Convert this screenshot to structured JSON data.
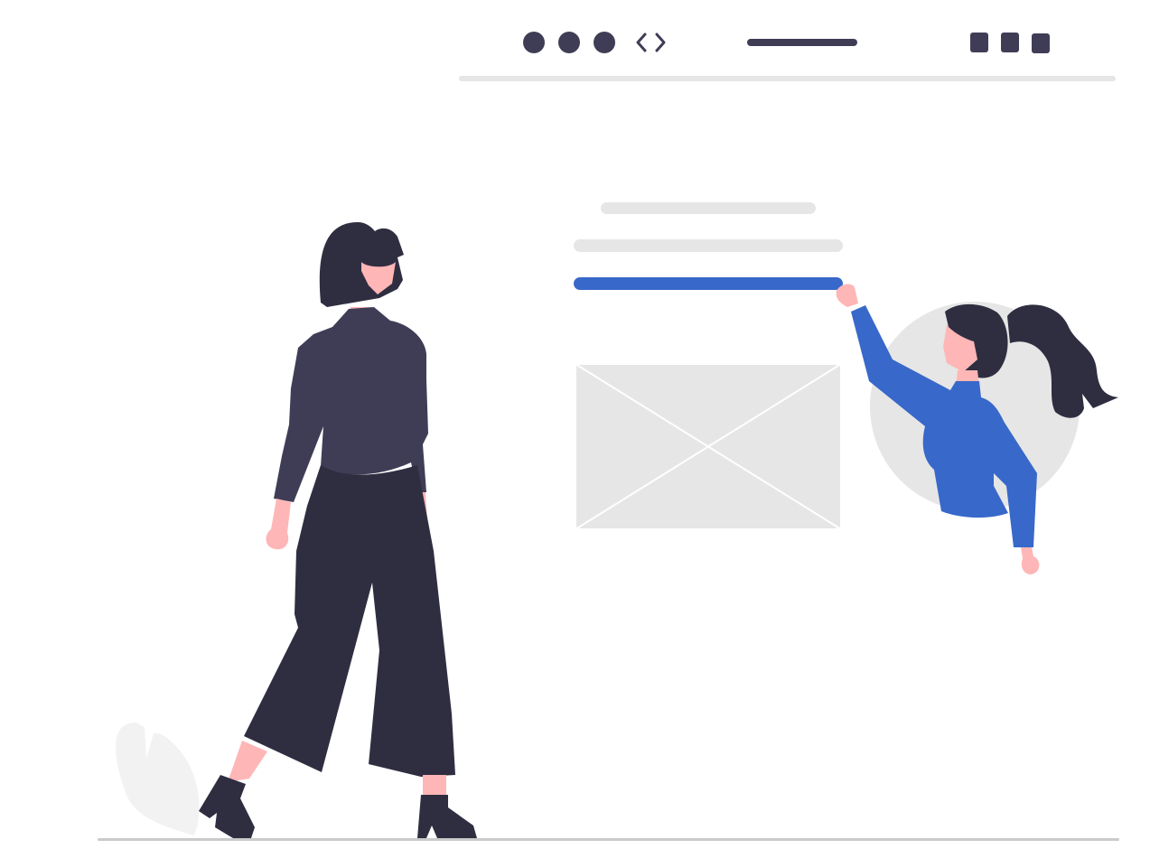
{
  "colors": {
    "dark": "#3f3d56",
    "ink": "#2f2e41",
    "light_gray": "#e6e6e6",
    "accent_blue": "#3868c9",
    "skin": "#ffb6b6",
    "white": "#ffffff",
    "leaf": "#f2f2f2"
  },
  "browser_window": {
    "dots": [
      "dot",
      "dot",
      "dot"
    ],
    "code_icon": "code-brackets-icon",
    "address_bar": "address-bar-line",
    "menu_squares": [
      "square",
      "square",
      "square"
    ]
  },
  "wireframe": {
    "text_lines": [
      "placeholder-line",
      "placeholder-line"
    ],
    "highlighted_line": "highlighted-line",
    "image_placeholder": "image-placeholder-icon"
  },
  "figures": [
    "standing-woman",
    "woman-in-circle-pointing",
    "decorative-leaf"
  ]
}
